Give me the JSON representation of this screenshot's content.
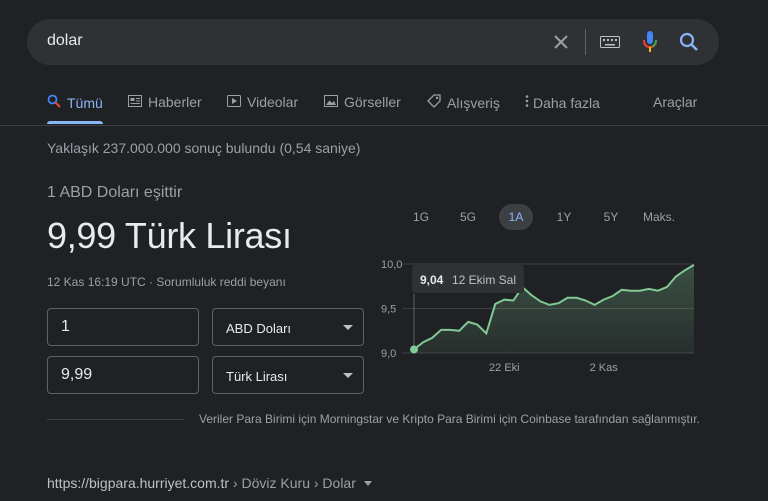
{
  "search": {
    "query": "dolar"
  },
  "tabs": [
    {
      "label": "Tümü",
      "icon": "search-icon"
    },
    {
      "label": "Haberler",
      "icon": "news-icon"
    },
    {
      "label": "Videolar",
      "icon": "video-icon"
    },
    {
      "label": "Görseller",
      "icon": "image-icon"
    },
    {
      "label": "Alışveriş",
      "icon": "tag-icon"
    },
    {
      "label": "Daha fazla",
      "icon": "more-vert-icon"
    }
  ],
  "tools_label": "Araçlar",
  "result_stats": "Yaklaşık 237.000.000 sonuç bulundu (0,54 saniye)",
  "converter": {
    "equals_text": "1 ABD Doları eşittir",
    "result_text": "9,99 Türk Lirası",
    "timestamp": "12 Kas 16:19 UTC · Sorumluluk reddi beyanı",
    "from_amount": "1",
    "from_currency": "ABD Doları",
    "to_amount": "9,99",
    "to_currency": "Türk Lirası"
  },
  "ranges": [
    "1G",
    "5G",
    "1A",
    "1Y",
    "5Y",
    "Maks."
  ],
  "selected_range": "1A",
  "chart_data": {
    "type": "area",
    "y_ticks": [
      "10,0",
      "9,5",
      "9,0"
    ],
    "ylim": [
      9.0,
      10.0
    ],
    "x_ticks": [
      {
        "label": "22 Eki",
        "index": 10
      },
      {
        "label": "2 Kas",
        "index": 21
      }
    ],
    "values": [
      9.04,
      9.12,
      9.17,
      9.26,
      9.26,
      9.25,
      9.35,
      9.32,
      9.22,
      9.55,
      9.6,
      9.59,
      9.74,
      9.65,
      9.58,
      9.54,
      9.56,
      9.62,
      9.62,
      9.59,
      9.54,
      9.6,
      9.64,
      9.71,
      9.7,
      9.7,
      9.72,
      9.7,
      9.74,
      9.86,
      9.93,
      9.99
    ],
    "tooltip": {
      "value": "9,04",
      "date": "12 Ekim Sal"
    },
    "line_color": "#81c995"
  },
  "attribution": "Veriler Para Birimi için Morningstar ve Kripto Para Birimi için Coinbase tarafından sağlanmıştır.",
  "source": {
    "domain": "https://bigpara.hurriyet.com.tr",
    "path": " › Döviz Kuru › Dolar"
  }
}
